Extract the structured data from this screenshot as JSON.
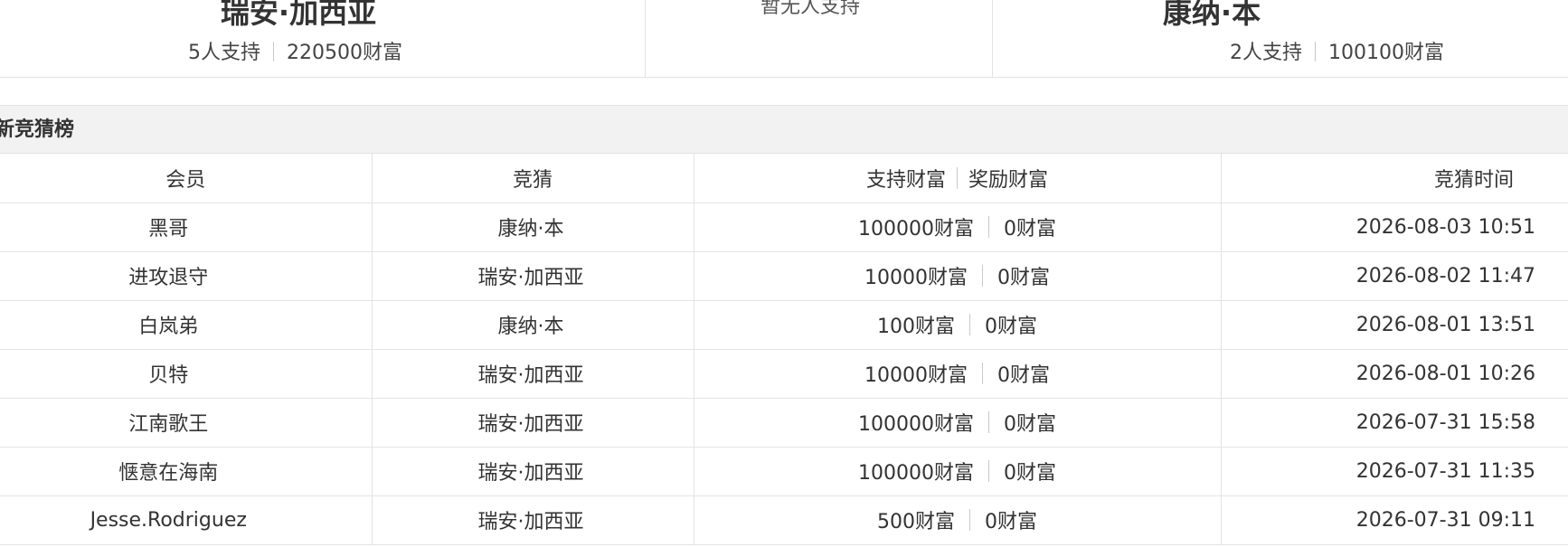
{
  "vote": {
    "left_team": {
      "name": "瑞安·加西亚",
      "supporters": "5人支持",
      "wealth": "220500财富"
    },
    "middle": {
      "text": "暂无人支持"
    },
    "right_team": {
      "name": "康纳·本",
      "supporters": "2人支持",
      "wealth": "100100财富"
    }
  },
  "ranking": {
    "title": "新竞猜榜",
    "columns": {
      "member": "会员",
      "guess": "竞猜",
      "support_wealth": "支持财富",
      "reward_wealth": "奖励财富",
      "time": "竞猜时间"
    },
    "rows": [
      {
        "member": "黑哥",
        "guess": "康纳·本",
        "support": "100000财富",
        "reward": "0财富",
        "time": "2026-08-03 10:51"
      },
      {
        "member": "进攻退守",
        "guess": "瑞安·加西亚",
        "support": "10000财富",
        "reward": "0财富",
        "time": "2026-08-02 11:47"
      },
      {
        "member": "白岚弟",
        "guess": "康纳·本",
        "support": "100财富",
        "reward": "0财富",
        "time": "2026-08-01 13:51"
      },
      {
        "member": "贝特",
        "guess": "瑞安·加西亚",
        "support": "10000财富",
        "reward": "0财富",
        "time": "2026-08-01 10:26"
      },
      {
        "member": "江南歌王",
        "guess": "瑞安·加西亚",
        "support": "100000财富",
        "reward": "0财富",
        "time": "2026-07-31 15:58"
      },
      {
        "member": "惬意在海南",
        "guess": "瑞安·加西亚",
        "support": "100000财富",
        "reward": "0财富",
        "time": "2026-07-31 11:35"
      },
      {
        "member": "Jesse.Rodriguez",
        "guess": "瑞安·加西亚",
        "support": "500财富",
        "reward": "0财富",
        "time": "2026-07-31 09:11"
      }
    ]
  }
}
